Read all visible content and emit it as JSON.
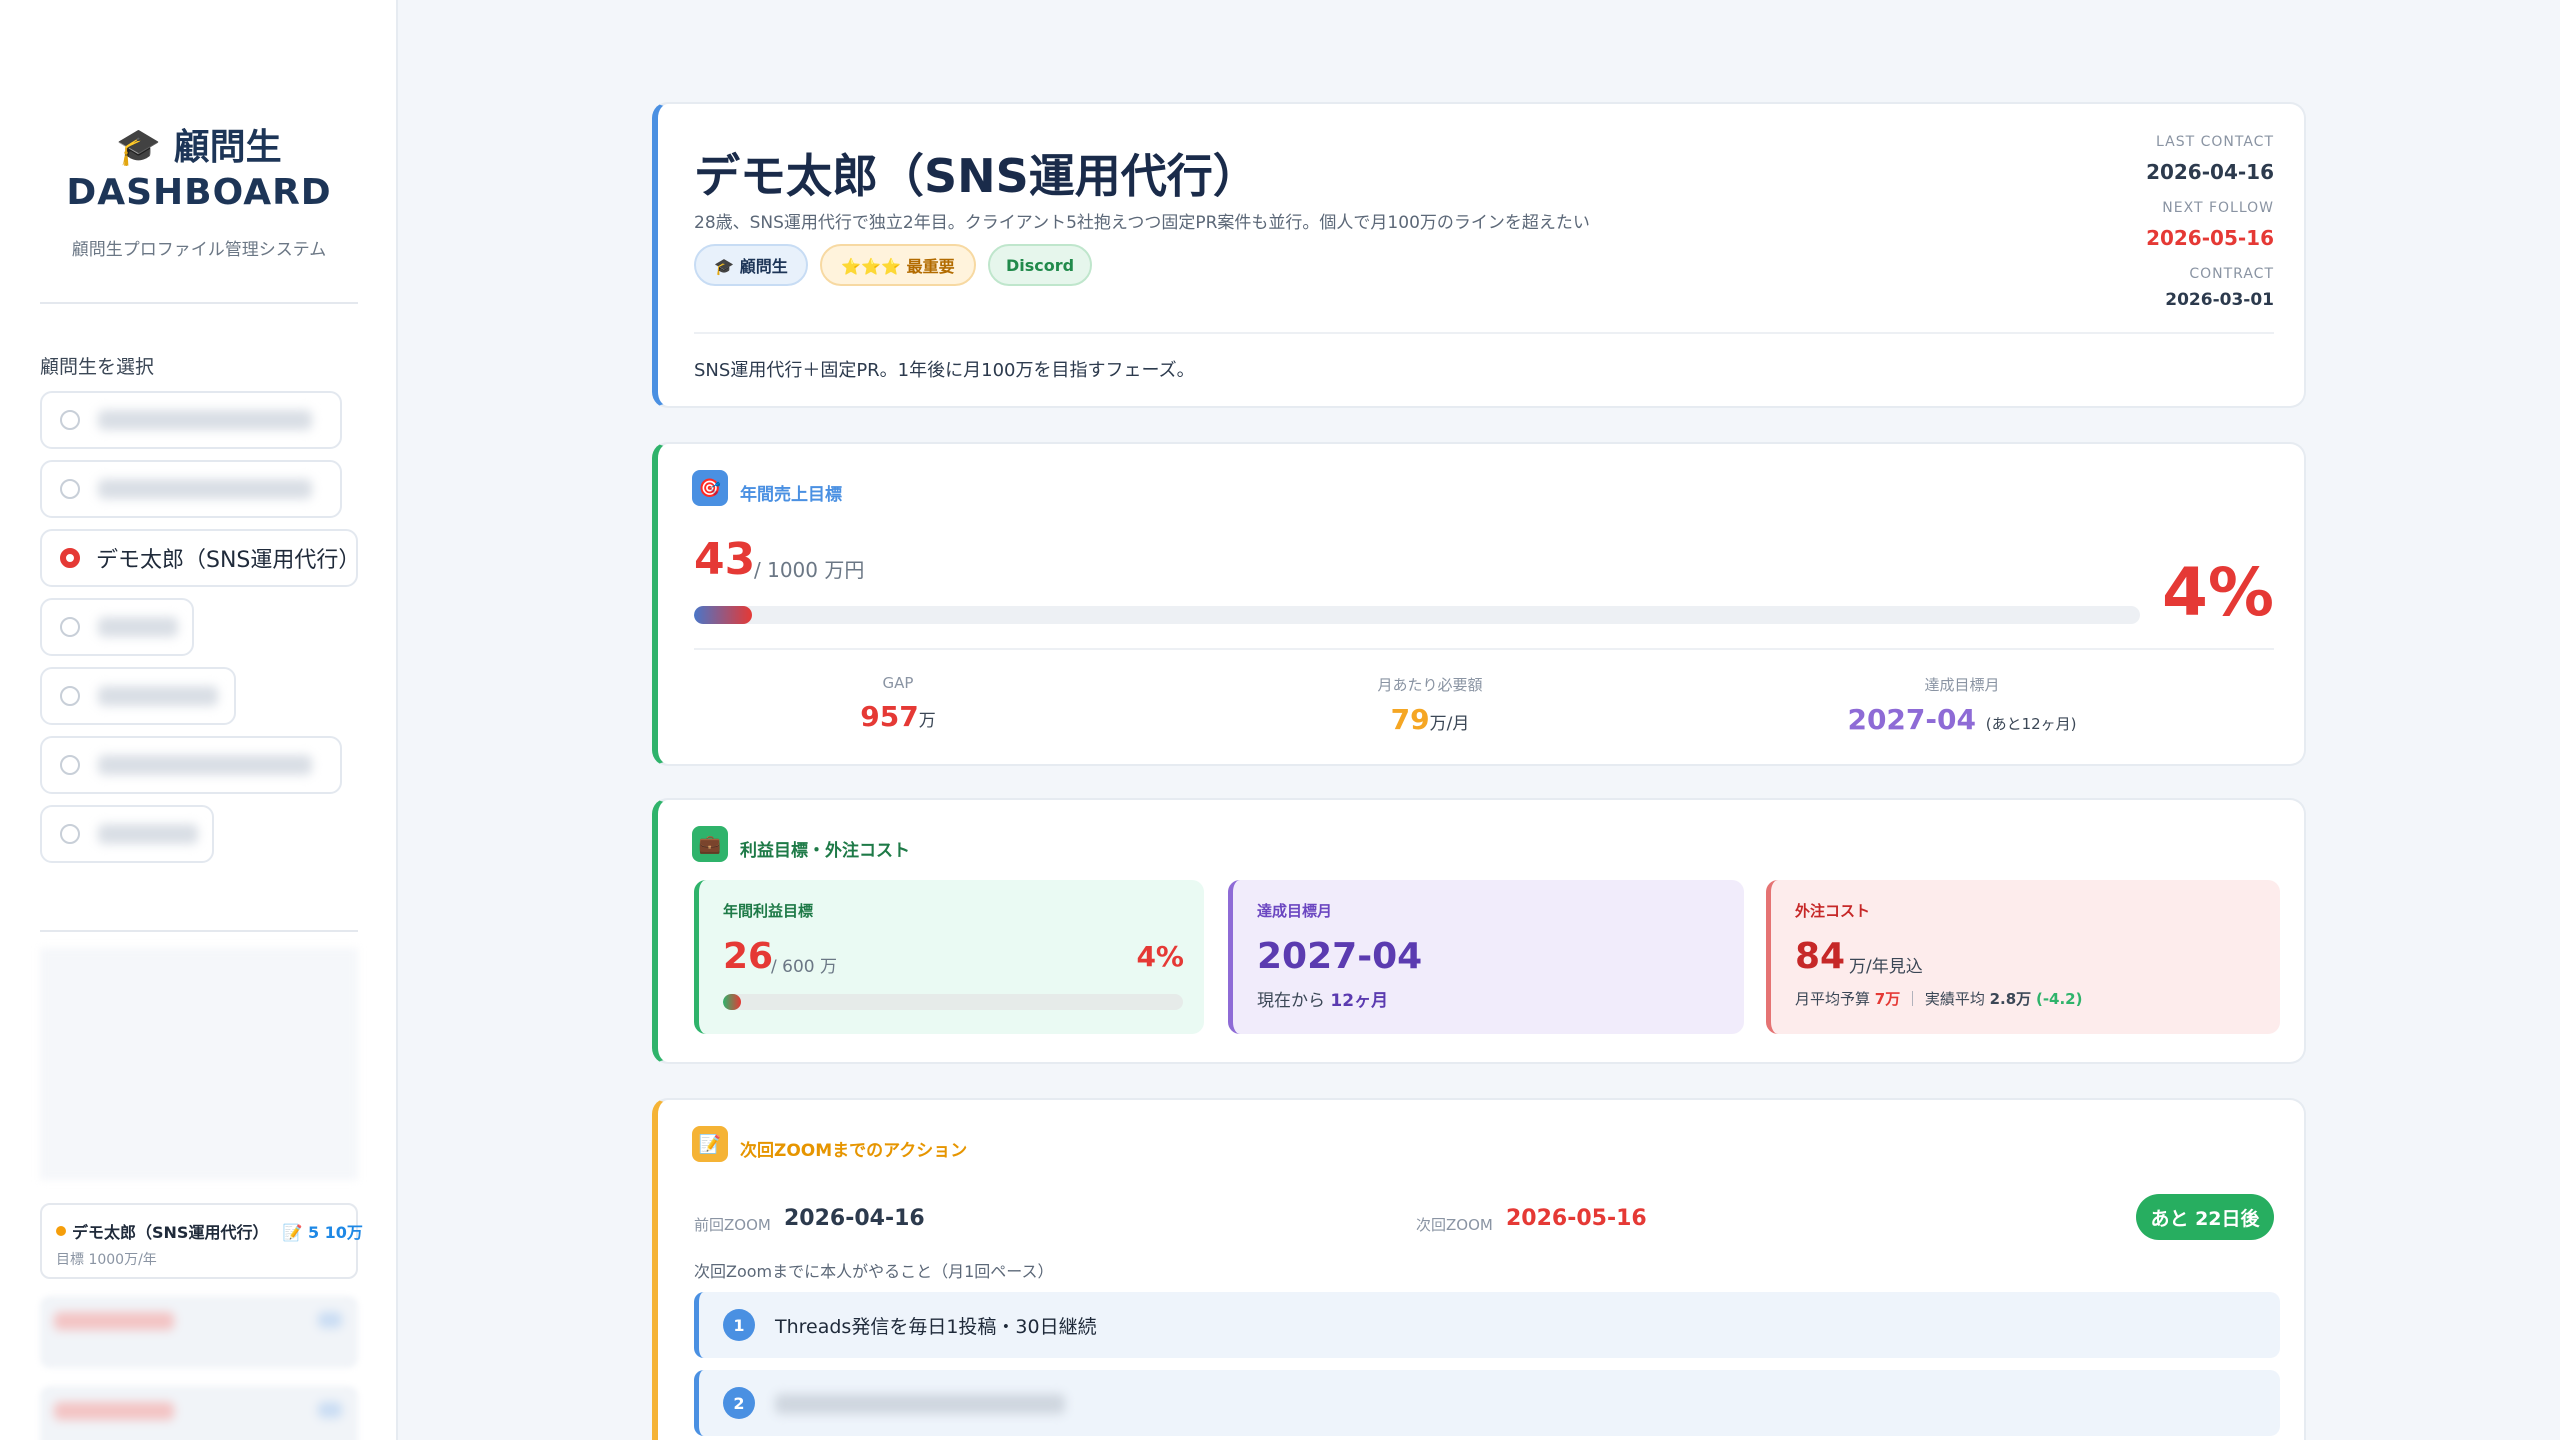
{
  "sidebar": {
    "brand_icon": "🎓",
    "brand_line1": "顧問生",
    "brand_line2": "DASHBOARD",
    "brand_sub": "顧問生プロファイル管理システム",
    "select_label": "顧問生を選択",
    "selected_client": "デモ太郎（SNS運用代行）",
    "mini_card": {
      "name": "デモ太郎（SNS運用代行）",
      "badge_icon": "📝",
      "badge": "5 10万",
      "target": "目標 1000万/年"
    }
  },
  "profile": {
    "name": "デモ太郎（SNS運用代行）",
    "description": "28歳、SNS運用代行で独立2年目。クライアント5社抱えつつ固定PR案件も並行。個人で月100万のラインを超えたい",
    "tags": [
      "🎓 顧問生",
      "⭐⭐⭐ 最重要",
      "Discord"
    ],
    "last_contact_label": "LAST CONTACT",
    "last_contact": "2026-04-16",
    "next_follow_label": "NEXT FOLLOW",
    "next_follow": "2026-05-16",
    "contract_label": "CONTRACT",
    "contract": "2026-03-01",
    "note": "SNS運用代行＋固定PR。1年後に月100万を目指すフェーズ。"
  },
  "revenue": {
    "icon": "🎯",
    "title": "年間売上目標",
    "current": "43",
    "target_text": "/ 1000 万円",
    "progress": 0.04,
    "percent_text": "4%",
    "gap_label": "GAP",
    "gap_value": "957",
    "gap_unit": "万",
    "monthly_label": "月あたり必要額",
    "monthly_value": "79",
    "monthly_unit": "万/月",
    "deadline_label": "達成目標月",
    "deadline_value": "2027-04",
    "deadline_note": "(あと12ヶ月)"
  },
  "profit": {
    "icon": "💼",
    "title": "利益目標・外注コスト",
    "annual_label": "年間利益目標",
    "annual_current": "26",
    "annual_target": "/ 600 万",
    "annual_percent": "4%",
    "annual_progress": 0.04,
    "month_label": "達成目標月",
    "month_value": "2027-04",
    "month_note_prefix": "現在から",
    "month_note_value": "12ヶ月",
    "cost_label": "外注コスト",
    "cost_value": "84",
    "cost_unit": "万/年見込",
    "cost_budget_label": "月平均予算",
    "cost_budget_value": "7万",
    "cost_sep": "｜",
    "cost_actual_label": "実績平均",
    "cost_actual_value": "2.8万",
    "cost_diff": "(-4.2)"
  },
  "zoom": {
    "icon": "📝",
    "title": "次回ZOOMまでのアクション",
    "prev_label": "前回ZOOM",
    "prev_date": "2026-04-16",
    "next_label": "次回ZOOM",
    "next_date": "2026-05-16",
    "countdown": "あと 22日後",
    "hint": "次回Zoomまでに本人がやること（月1回ペース）",
    "actions": [
      {
        "num": "1",
        "text": "Threads発信を毎日1投稿・30日継続"
      },
      {
        "num": "2",
        "text": ""
      }
    ]
  },
  "colors": {
    "accent_blue": "#4a90e2",
    "accent_red": "#e53935",
    "accent_green": "#2fb36b",
    "accent_orange": "#f5a623",
    "accent_purple": "#8e6bd6"
  }
}
